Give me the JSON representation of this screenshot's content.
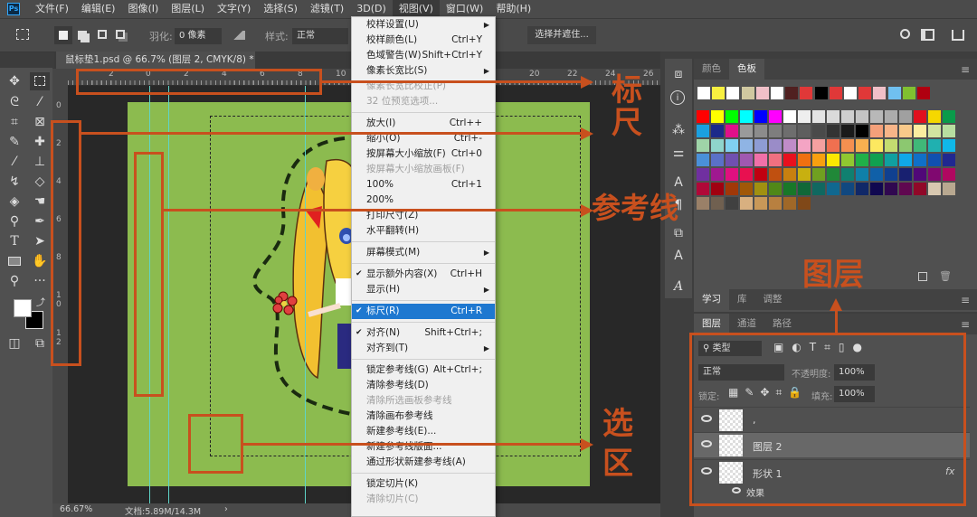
{
  "app": {
    "logo": "Ps"
  },
  "menubar": [
    "文件(F)",
    "编辑(E)",
    "图像(I)",
    "图层(L)",
    "文字(Y)",
    "选择(S)",
    "滤镜(T)",
    "3D(D)",
    "视图(V)",
    "窗口(W)",
    "帮助(H)"
  ],
  "options": {
    "feather_label": "羽化:",
    "feather_value": "0 像素",
    "style_label": "样式:",
    "style_value": "正常",
    "select_mask": "选择并遮住..."
  },
  "document": {
    "tab_title": "鼠标垫1.psd @ 66.7% (图层 2, CMYK/8) *",
    "close": "×"
  },
  "ruler": {
    "h_ticks": [
      "2",
      "0",
      "2",
      "4",
      "6",
      "8",
      "10",
      "20",
      "22",
      "24",
      "26"
    ],
    "v_ticks": [
      "0",
      "2",
      "4",
      "6",
      "8",
      "1 0",
      "1 2"
    ]
  },
  "status": {
    "zoom": "66.67%",
    "doc_size": "文档:5.89M/14.3M",
    "arrow": "›"
  },
  "view_menu": {
    "items": [
      {
        "label": "校样设置(U)",
        "submenu": true
      },
      {
        "label": "校样颜色(L)",
        "shortcut": "Ctrl+Y"
      },
      {
        "label": "色域警告(W)",
        "shortcut": "Shift+Ctrl+Y"
      },
      {
        "label": "像素长宽比(S)",
        "submenu": true
      },
      {
        "label": "像素长宽比校正(P)",
        "disabled": true
      },
      {
        "label": "32 位预览选项...",
        "disabled": true
      },
      {
        "sep": true
      },
      {
        "label": "放大(I)",
        "shortcut": "Ctrl++"
      },
      {
        "label": "缩小(O)",
        "shortcut": "Ctrl+-"
      },
      {
        "label": "按屏幕大小缩放(F)",
        "shortcut": "Ctrl+0"
      },
      {
        "label": "按屏幕大小缩放画板(F)",
        "disabled": true
      },
      {
        "label": "100%",
        "shortcut": "Ctrl+1"
      },
      {
        "label": "200%"
      },
      {
        "label": "打印尺寸(Z)"
      },
      {
        "label": "水平翻转(H)"
      },
      {
        "sep": true
      },
      {
        "label": "屏幕模式(M)",
        "submenu": true
      },
      {
        "sep": true
      },
      {
        "label": "显示额外内容(X)",
        "shortcut": "Ctrl+H",
        "checked": true
      },
      {
        "label": "显示(H)",
        "submenu": true
      },
      {
        "sep": true
      },
      {
        "label": "标尺(R)",
        "shortcut": "Ctrl+R",
        "checked": true,
        "highlighted": true
      },
      {
        "sep": true
      },
      {
        "label": "对齐(N)",
        "shortcut": "Shift+Ctrl+;",
        "checked": true
      },
      {
        "label": "对齐到(T)",
        "submenu": true
      },
      {
        "sep": true
      },
      {
        "label": "锁定参考线(G)",
        "shortcut": "Alt+Ctrl+;"
      },
      {
        "label": "清除参考线(D)"
      },
      {
        "label": "清除所选画板参考线",
        "disabled": true
      },
      {
        "label": "清除画布参考线"
      },
      {
        "label": "新建参考线(E)..."
      },
      {
        "label": "新建参考线版面..."
      },
      {
        "label": "通过形状新建参考线(A)"
      },
      {
        "sep": true
      },
      {
        "label": "锁定切片(K)"
      },
      {
        "label": "清除切片(C)",
        "disabled": true
      }
    ]
  },
  "color_panel": {
    "tabs": [
      "颜色",
      "色板"
    ],
    "active": 1,
    "recent": [
      "#ffffff",
      "#f8f040",
      "#ffffff",
      "#d0c8a0",
      "#f0c0c8",
      "#ffffff",
      "#502020",
      "#e03838",
      "#000000",
      "#e03838",
      "#ffffff",
      "#e03838",
      "#f0c0c8",
      "#70c0f0",
      "#80c030",
      "#b00010"
    ],
    "swatches": [
      [
        "#ff0000",
        "#ffff00",
        "#00ff00",
        "#00ffff",
        "#0000ff",
        "#ff00ff",
        "#ffffff",
        "#eeeeee",
        "#e4e4e4",
        "#dadada",
        "#cfcfcf",
        "#c4c4c4",
        "#b8b8b8",
        "#acacac",
        "#a0a0a0",
        "#e0101e",
        "#f5d800",
        "#0a9a4a"
      ],
      [
        "#1ba0e0",
        "#1c2a8a",
        "#e0108a",
        "#9a9a9a",
        "#8c8c8c",
        "#7e7e7e",
        "#6e6e6e",
        "#5e5e5e",
        "#4a4a4a",
        "#333333",
        "#1a1a1a",
        "#000000",
        "#f4a07a",
        "#f7b488",
        "#f8c98a",
        "#fbeda0",
        "#d2e4a0",
        "#b8dea0"
      ],
      [
        "#9fd4a8",
        "#8fd4cc",
        "#80d0f0",
        "#8fb4e4",
        "#8e9cd4",
        "#9a8cc8",
        "#c08cc8",
        "#f4a4c4",
        "#f4a0a0",
        "#f07050",
        "#f49050",
        "#f8b050",
        "#fce860",
        "#c4dc70",
        "#8cc870",
        "#40b878",
        "#20b0b0",
        "#10b8e8"
      ],
      [
        "#4a90d8",
        "#5a70c8",
        "#7050b0",
        "#a058b0",
        "#f070a8",
        "#f07080",
        "#e8101e",
        "#f07010",
        "#f8a010",
        "#fce800",
        "#90c830",
        "#20b048",
        "#10a050",
        "#10a0a0",
        "#10a8e8",
        "#1070c8",
        "#1050b0",
        "#202890"
      ],
      [
        "#7030a0",
        "#a01890",
        "#e01080",
        "#e81050",
        "#c00010",
        "#c05010",
        "#c88010",
        "#c8b010",
        "#70a020",
        "#208838",
        "#108070",
        "#1080a8",
        "#1060a8",
        "#104090",
        "#182070",
        "#500878",
        "#800870",
        "#b00860"
      ],
      [
        "#b00838",
        "#a00010",
        "#a03808",
        "#a05808",
        "#a09010",
        "#508818",
        "#187828",
        "#106838",
        "#106860",
        "#106890",
        "#104880",
        "#102868",
        "#100850",
        "#300850",
        "#600850",
        "#900828",
        "#d8c8b0",
        "#b8a890"
      ],
      [
        "#9a8068",
        "#706050",
        "#404040",
        "#d8b080",
        "#c89858",
        "#b88040",
        "#a06828",
        "#804818"
      ]
    ]
  },
  "learn_panel": {
    "tabs": [
      "学习",
      "库",
      "调整"
    ]
  },
  "layers_panel": {
    "tabs": [
      "图层",
      "通道",
      "路径"
    ],
    "filter": "类型",
    "blend_mode": "正常",
    "opacity_label": "不透明度:",
    "opacity": "100%",
    "lock_label": "锁定:",
    "fill_label": "填充:",
    "fill": "100%",
    "layers": [
      {
        "name": ",",
        "selected": false
      },
      {
        "name": "图层 2",
        "selected": true
      },
      {
        "name": "形状 1",
        "selected": false,
        "fx": "fx"
      }
    ],
    "effect_label": "效果"
  },
  "annotations": {
    "ruler": "标尺",
    "guides": "参考线",
    "layers": "图层",
    "selection": "选区",
    "color": "#c8501e"
  }
}
